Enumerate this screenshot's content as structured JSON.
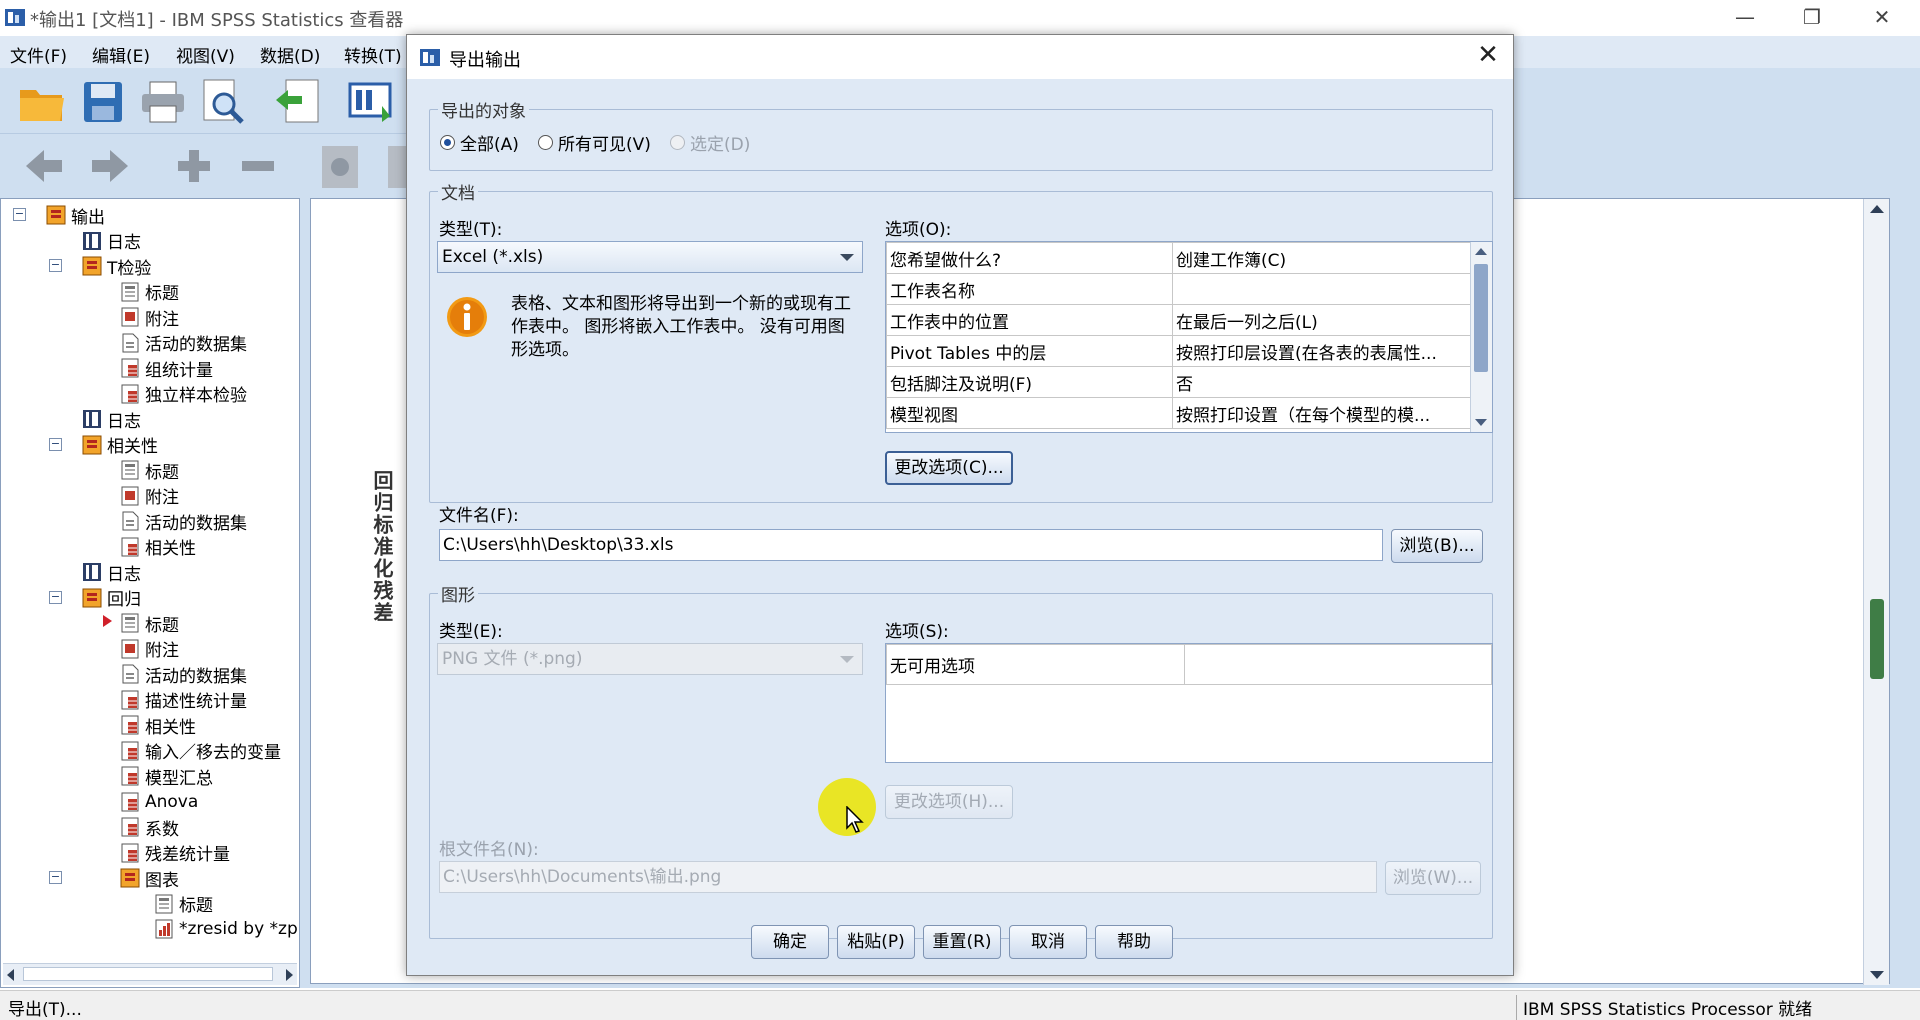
{
  "window": {
    "title": "*输出1 [文档1] - IBM SPSS Statistics 查看器",
    "minimize_label": "—",
    "restore_label": "❐",
    "close_label": "✕"
  },
  "menubar": {
    "items": [
      "文件(F)",
      "编辑(E)",
      "视图(V)",
      "数据(D)",
      "转换(T)"
    ]
  },
  "tree": {
    "items": [
      {
        "label": "输出"
      },
      {
        "label": "日志"
      },
      {
        "label": "T检验"
      },
      {
        "label": "标题"
      },
      {
        "label": "附注"
      },
      {
        "label": "活动的数据集"
      },
      {
        "label": "组统计量"
      },
      {
        "label": "独立样本检验"
      },
      {
        "label": "日志"
      },
      {
        "label": "相关性"
      },
      {
        "label": "标题"
      },
      {
        "label": "附注"
      },
      {
        "label": "活动的数据集"
      },
      {
        "label": "相关性"
      },
      {
        "label": "日志"
      },
      {
        "label": "回归"
      },
      {
        "label": "标题"
      },
      {
        "label": "附注"
      },
      {
        "label": "活动的数据集"
      },
      {
        "label": "描述性统计量"
      },
      {
        "label": "相关性"
      },
      {
        "label": "输入／移去的变量"
      },
      {
        "label": "模型汇总"
      },
      {
        "label": "Anova"
      },
      {
        "label": "系数"
      },
      {
        "label": "残差统计量"
      },
      {
        "label": "图表"
      },
      {
        "label": "标题"
      },
      {
        "label": "*zresid by *zp"
      }
    ]
  },
  "content": {
    "vertical_title": "回归标准化残差"
  },
  "statusbar": {
    "left": "导出(T)...",
    "right": "IBM SPSS Statistics Processor 就绪"
  },
  "dialog": {
    "title": "导出输出",
    "close_label": "✕",
    "objects_group": {
      "title": "导出的对象",
      "options": [
        {
          "label": "全部(A)",
          "selected": true,
          "enabled": true
        },
        {
          "label": "所有可见(V)",
          "selected": false,
          "enabled": true
        },
        {
          "label": "选定(D)",
          "selected": false,
          "enabled": false
        }
      ]
    },
    "document_group": {
      "title": "文档",
      "type_label": "类型(T):",
      "type_value": "Excel (*.xls)",
      "info_text": "表格、文本和图形将导出到一个新的或现有工作表中。 图形将嵌入工作表中。 没有可用图形选项。",
      "options_label": "选项(O):",
      "options_rows": [
        {
          "name": "您希望做什么?",
          "value": "创建工作簿(C)"
        },
        {
          "name": "工作表名称",
          "value": ""
        },
        {
          "name": "工作表中的位置",
          "value": "在最后一列之后(L)"
        },
        {
          "name": "Pivot Tables 中的层",
          "value": "按照打印层设置(在各表的表属性..."
        },
        {
          "name": "包括脚注及说明(F)",
          "value": "否"
        },
        {
          "name": "模型视图",
          "value": "按照打印设置（在每个模型的模..."
        }
      ],
      "change_options_button": "更改选项(C)...",
      "filename_label": "文件名(F):",
      "filename_value": "C:\\Users\\hh\\Desktop\\33.xls",
      "browse_button": "浏览(B)..."
    },
    "graphics_group": {
      "title": "图形",
      "type_label": "类型(E):",
      "type_value": "PNG 文件 (*.png)",
      "options_label": "选项(S):",
      "options_rows": [
        {
          "name": "无可用选项",
          "value": ""
        }
      ],
      "change_options_button": "更改选项(H)...",
      "root_filename_label": "根文件名(N):",
      "root_filename_value": "C:\\Users\\hh\\Documents\\输出.png",
      "browse_button": "浏览(W)..."
    },
    "buttons": {
      "ok": "确定",
      "paste": "粘贴(P)",
      "reset": "重置(R)",
      "cancel": "取消",
      "help": "帮助"
    }
  }
}
